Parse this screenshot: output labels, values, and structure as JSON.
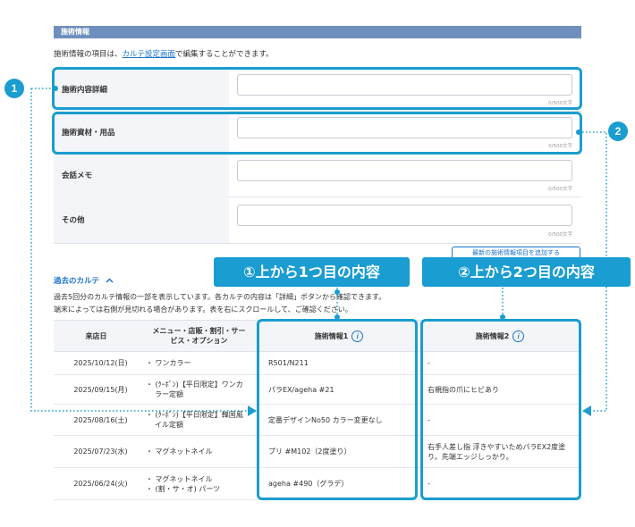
{
  "section": {
    "title": "施術情報"
  },
  "intro": {
    "prefix": "施術情報の項目は、",
    "link": "カルテ設定画面",
    "suffix": "で編集することができます。"
  },
  "form": {
    "rows": [
      {
        "label": "施術内容詳細",
        "count": "0/500文字"
      },
      {
        "label": "施術資材・用品",
        "count": "0/500文字"
      },
      {
        "label": "会話メモ",
        "count": "0/500文字"
      },
      {
        "label": "その他",
        "count": "0/500文字"
      }
    ]
  },
  "hidden_button": {
    "label": "最新の施術情報項目を追加する"
  },
  "past": {
    "title": "過去のカルテ",
    "chevron": "chevron-up-icon",
    "desc1": "過去5回分のカルテ情報の一部を表示しています。各カルテの内容は「詳細」ボタンから確認できます。",
    "desc2": "端末によっては右側が見切れる場合があります。表を右にスクロールして、ご確認ください。"
  },
  "table": {
    "headers": [
      "来店日",
      "メニュー・店販・割引・サービス・オプション",
      "施術情報1",
      "施術情報2"
    ],
    "rows": [
      {
        "date": "2025/10/12(日)",
        "menu": [
          "・ ワンカラー"
        ],
        "info1": "R501/N211",
        "info2": "-"
      },
      {
        "date": "2025/09/15(月)",
        "menu": [
          "・ (ｸｰﾎﾟﾝ)【平日限定】ワンカ",
          "ラー定額"
        ],
        "info1": "パラEX/ageha #21",
        "info2": "右親指の爪にヒビあり"
      },
      {
        "date": "2025/08/16(土)",
        "menu": [
          "・ (ｸｰﾎﾟﾝ)【平日限定】韓国風",
          "イル定額"
        ],
        "info1": "定番デザインNo50 カラー変更なし",
        "info2": "-"
      },
      {
        "date": "2025/07/23(水)",
        "menu": [
          "・ マグネットネイル"
        ],
        "info1": "プリ #M102（2度塗り）",
        "info2": "右手人差し指 浮きやすいためパラEX2度塗り。先端エッジしっかり。"
      },
      {
        "date": "2025/06/24(火)",
        "menu": [
          "・ マグネットネイル",
          "・ (割・サ・オ) パーツ"
        ],
        "info1": "ageha #490（グラデ）",
        "info2": "-"
      }
    ]
  },
  "annotations": {
    "badge1": "1",
    "badge2": "2",
    "callout1": "①上から1つ目の内容",
    "callout2": "②上から2つ目の内容",
    "accent": "#1a9dd0"
  }
}
